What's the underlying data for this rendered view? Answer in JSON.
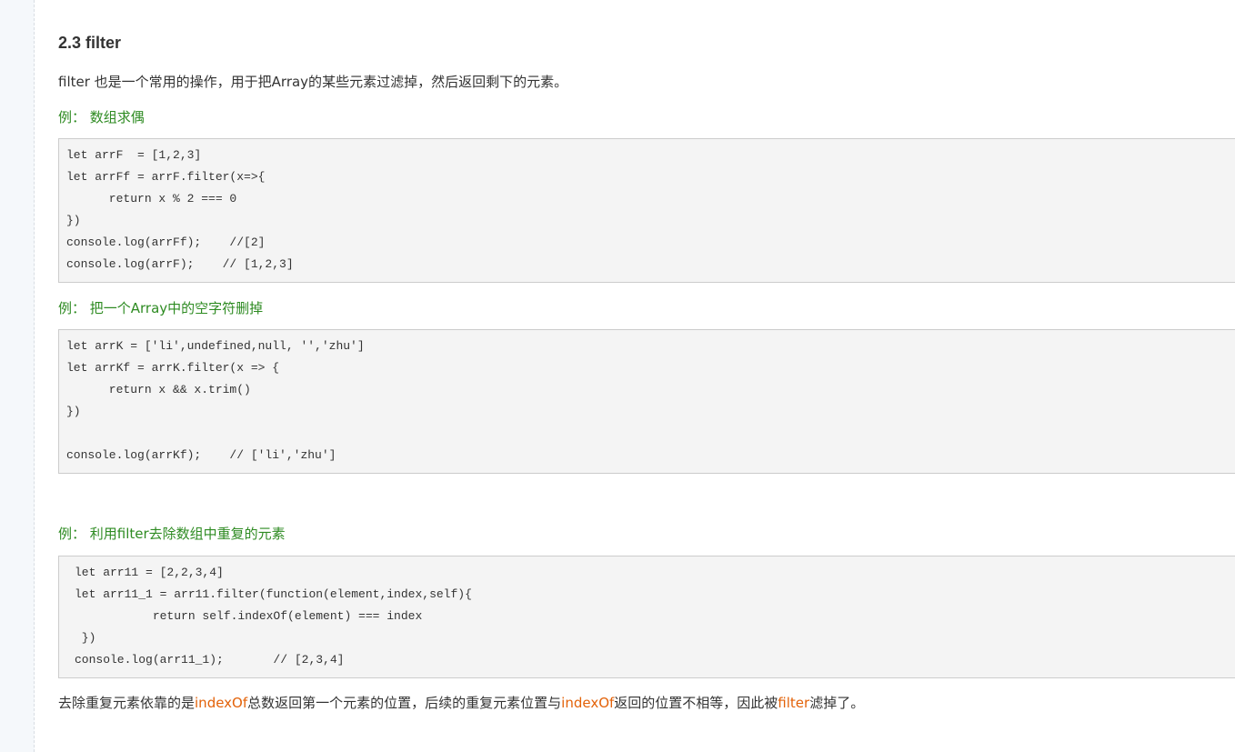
{
  "section": {
    "title": "2.3 filter",
    "intro": "filter 也是一个常用的操作，用于把Array的某些元素过滤掉，然后返回剩下的元素。"
  },
  "examples": [
    {
      "label": "例：  数组求偶",
      "code": [
        "let arrF  = [1,2,3]",
        "let arrFf = arrF.filter(x=>{",
        "      return x % 2 === 0",
        "})",
        "console.log(arrFf);    //[2]",
        "console.log(arrF);    // [1,2,3]"
      ]
    },
    {
      "label": "例：  把一个Array中的空字符删掉",
      "code": [
        "let arrK = ['li',undefined,null, '','zhu']",
        "let arrKf = arrK.filter(x => {",
        "      return x && x.trim()",
        "})",
        "",
        "console.log(arrKf);    // ['li','zhu']"
      ]
    },
    {
      "label": "例：  利用filter去除数组中重复的元素",
      "code": [
        "let arr11 = [2,2,3,4]",
        "let arr11_1 = arr11.filter(function(element,index,self){",
        "           return self.indexOf(element) === index",
        " })",
        "console.log(arr11_1);       // [2,3,4]"
      ]
    }
  ],
  "conclusion": {
    "part1": "去除重复元素依靠的是",
    "hl1": "indexOf",
    "part2": "总数返回第一个元素的位置，后续的重复元素位置与",
    "hl2": "indexOf",
    "part3": "返回的位置不相等，因此被",
    "hl3": "filter",
    "part4": "滤掉了。"
  },
  "colors": {
    "example_label": "#2e8b22",
    "highlight": "#e36209",
    "code_bg": "#f4f4f4"
  }
}
